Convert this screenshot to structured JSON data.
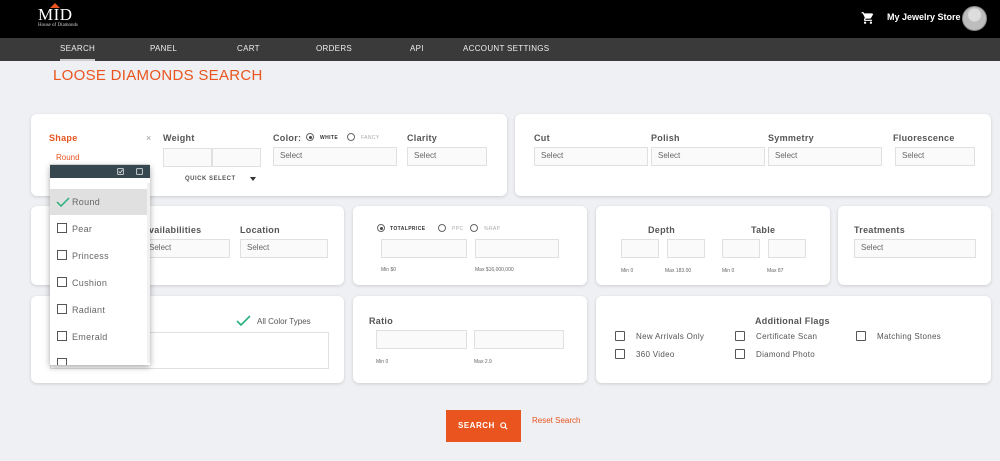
{
  "brand": {
    "logo": "MID",
    "logo_sub": "House of Diamonds",
    "store": "My Jewelry Store",
    "accent": "#e9541f"
  },
  "nav": [
    "SEARCH",
    "PANEL",
    "CART",
    "ORDERS",
    "API",
    "ACCOUNT SETTINGS"
  ],
  "page_title": "LOOSE DIAMONDS SEARCH",
  "shape": {
    "label": "Shape",
    "value": "Round",
    "clear": "×",
    "quick": "QUICK SELECT",
    "options": [
      "Round",
      "Pear",
      "Princess",
      "Cushion",
      "Radiant",
      "Emerald"
    ],
    "selected": "Round"
  },
  "weight": {
    "label": "Weight"
  },
  "color": {
    "label": "Color:",
    "white": "WHITE",
    "fancy": "FANCY",
    "placeholder": "Select",
    "all_types": "All Color Types"
  },
  "clarity": {
    "label": "Clarity",
    "placeholder": "Select"
  },
  "grading": {
    "cut": "Cut",
    "polish": "Polish",
    "symmetry": "Symmetry",
    "fluorescence": "Fluorescence",
    "placeholder": "Select"
  },
  "avail": {
    "label": "Availabilities",
    "partial": "vailabilities",
    "placeholder": "Select",
    "location": "Location"
  },
  "price": {
    "total": "TOTALPRICE",
    "ppc": "PPC",
    "rap": "%RAP",
    "min": "Min $0",
    "max": "Max $16,000,000"
  },
  "dims": {
    "depth": "Depth",
    "table": "Table",
    "dmin": "Min 0",
    "dmax": "Max 183.00",
    "tmin": "Min 0",
    "tmax": "Max 87"
  },
  "treatments": {
    "label": "Treatments",
    "placeholder": "Select"
  },
  "ratio": {
    "label": "Ratio",
    "min": "Min 0",
    "max": "Max 2.9"
  },
  "flags": {
    "label": "Additional Flags",
    "items": [
      "New Arrivals Only",
      "Certificate Scan",
      "Matching Stones",
      "360 Video",
      "Diamond Photo"
    ]
  },
  "actions": {
    "search": "SEARCH",
    "reset": "Reset Search"
  }
}
